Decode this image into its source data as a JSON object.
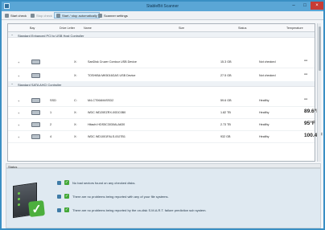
{
  "window": {
    "title": "StableBit Scanner"
  },
  "toolbar": {
    "start_check": "Start check",
    "stop_check": "Stop check",
    "start_stop_auto": "Start / stop automatically",
    "scanner_settings": "Scanner settings"
  },
  "table": {
    "headers": [
      "Bay",
      "Drive Letter",
      "Name",
      "Size",
      "Status",
      "Temperature"
    ],
    "controllers": [
      {
        "label": "Standard Enhanced PCI to USB Host Controller",
        "rows": [
          {
            "bay": "",
            "drive": "X:",
            "name": "SanDisk Cruzer Contour USB Device",
            "size": "15.3 GB",
            "status": "Not checked",
            "temp": "--"
          },
          {
            "bay": "",
            "drive": "X:",
            "name": "TOSHIBA MK5016GAS USB Device",
            "size": "27.5 GB",
            "status": "Not checked",
            "temp": "--"
          }
        ]
      },
      {
        "label": "Standard SATA AHCI Controller",
        "rows": [
          {
            "bay": "SSD",
            "drive": "C:",
            "name": "M4-CT064M4SSD2",
            "size": "59.6 GB",
            "status": "Healthy",
            "temp": "--"
          },
          {
            "bay": "1",
            "drive": "X:",
            "name": "WDC WD20EZRX-00DC0B0",
            "size": "1.82 TB",
            "status": "Healthy",
            "temp": "89.6°F"
          },
          {
            "bay": "2",
            "drive": "X:",
            "name": "Hitachi HDS5C3030ALA630",
            "size": "2.73 TB",
            "status": "Healthy",
            "temp": "95°F"
          },
          {
            "bay": "4",
            "drive": "X:",
            "name": "WDC WD1001FALS-00J7B1",
            "size": "932 GB",
            "status": "Healthy",
            "temp": "100.4°F"
          }
        ]
      }
    ]
  },
  "status": {
    "title": "Status",
    "lines": [
      "No bad sectors found on any checked disks.",
      "There are no problems being reported with any of your file systems.",
      "There are no problems being reported by the on-disk S.M.A.R.T. failure prediction sub system."
    ]
  },
  "icons": {
    "app": "scanner-app-icon",
    "disk": "disk-icon",
    "check": "check-icon",
    "info": "info-icon"
  }
}
